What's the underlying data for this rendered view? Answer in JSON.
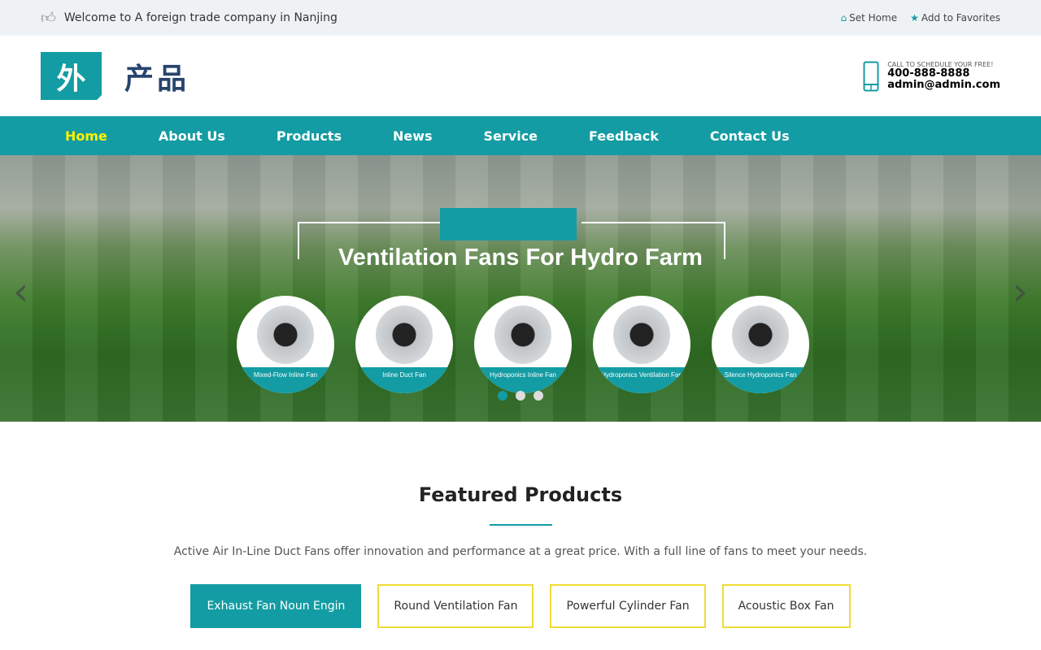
{
  "topbar": {
    "welcome": "Welcome to A foreign trade company in Nanjing",
    "set_home": "Set Home",
    "favorites": "Add to Favorites"
  },
  "header": {
    "logo_char": "外",
    "logo_text": "产品",
    "call_label": "CALL TO SCHEDULE YOUR FREE!",
    "phone": "400-888-8888",
    "email": "admin@admin.com"
  },
  "nav": [
    "Home",
    "About Us",
    "Products",
    "News",
    "Service",
    "Feedback",
    "Contact Us"
  ],
  "banner": {
    "title": "Ventilation Fans For Hydro Farm",
    "fans": [
      "Mixed-Flow Inline Fan",
      "Inline Duct Fan",
      "Hydroponics Inline Fan",
      "Hydroponics Ventilation Fan",
      "Silence Hydroponics Fan"
    ],
    "active_slide": 1,
    "slide_count": 3
  },
  "featured": {
    "title": "Featured Products",
    "desc": "Active Air In-Line Duct Fans offer innovation and performance at a great price. With a full line of fans to meet your needs.",
    "tabs": [
      "Exhaust Fan Noun Engin",
      "Round Ventilation Fan",
      "Powerful Cylinder Fan",
      "Acoustic Box Fan"
    ]
  },
  "colors": {
    "accent": "#139ca3",
    "nav_active": "#fff200",
    "tab_border": "#f0dc36"
  }
}
